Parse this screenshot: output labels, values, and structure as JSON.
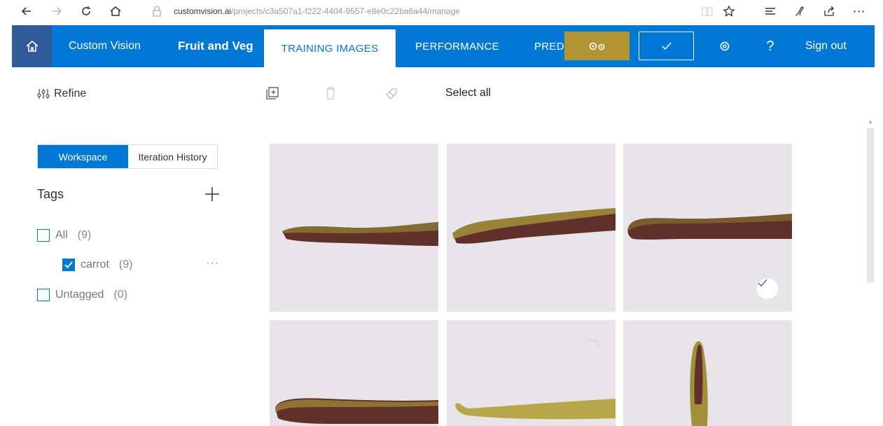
{
  "browser": {
    "url_host": "customvision.ai",
    "url_path": "/projects/c3a507a1-f222-4404-9557-e8e0c22ba6a44/manage"
  },
  "header": {
    "product_name": "Custom Vision",
    "project_name": "Fruit and Veg",
    "tabs": [
      {
        "label": "TRAINING IMAGES",
        "active": true
      },
      {
        "label": "PERFORMANCE",
        "active": false
      },
      {
        "label": "PREDI",
        "active": false
      }
    ],
    "sign_out_label": "Sign out",
    "train_button_color": "#b19433",
    "accent_color": "#0078d4"
  },
  "toolbar": {
    "refine_label": "Refine",
    "select_all_label": "Select all"
  },
  "sidebar": {
    "workspace_label": "Workspace",
    "iteration_history_label": "Iteration History",
    "tags_title": "Tags",
    "tags": [
      {
        "label": "All",
        "count": "(9)",
        "checked": false
      },
      {
        "label": "carrot",
        "count": "(9)",
        "checked": true
      },
      {
        "label": "Untagged",
        "count": "(0)",
        "checked": false
      }
    ]
  },
  "images": {
    "selected_index": 2
  }
}
